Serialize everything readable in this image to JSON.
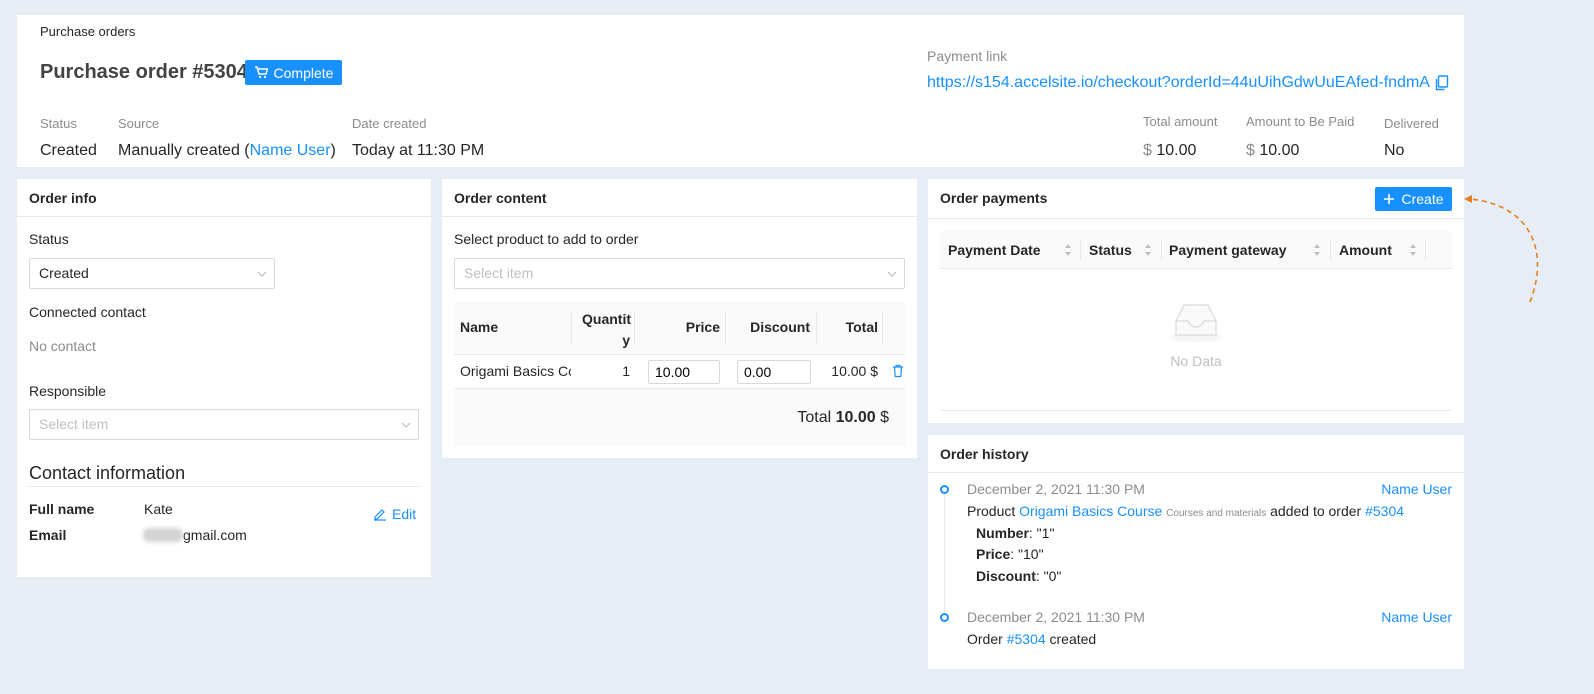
{
  "header": {
    "breadcrumb": "Purchase orders",
    "title": "Purchase order #5304",
    "complete_label": "Complete",
    "status_label": "Status",
    "status_value": "Created",
    "source_label": "Source",
    "source_prefix": "Manually created (",
    "source_user": "Name User",
    "source_suffix": ")",
    "date_label": "Date created",
    "date_value": "Today at 11:30 PM",
    "payment_link_label": "Payment link",
    "payment_link": "https://s154.accelsite.io/checkout?orderId=44uUihGdwUuEAfed-fndmA",
    "total_label": "Total amount",
    "total_currency": "$",
    "total_value": "10.00",
    "to_pay_label": "Amount to Be Paid",
    "to_pay_currency": "$",
    "to_pay_value": "10.00",
    "delivered_label": "Delivered",
    "delivered_value": "No"
  },
  "order_info": {
    "title": "Order info",
    "status_label": "Status",
    "status_value": "Created",
    "contact_label": "Connected contact",
    "contact_value": "No contact",
    "responsible_label": "Responsible",
    "responsible_placeholder": "Select item",
    "contact_info_title": "Contact information",
    "full_name_label": "Full name",
    "full_name_value": "Kate",
    "edit_label": "Edit",
    "email_label": "Email",
    "email_value": "gmail.com"
  },
  "order_content": {
    "title": "Order content",
    "select_label": "Select product to add to order",
    "select_placeholder": "Select item",
    "columns": {
      "name": "Name",
      "quantity_1": "Quantit",
      "quantity_2": "y",
      "price": "Price",
      "discount": "Discount",
      "total": "Total"
    },
    "row": {
      "name": "Origami Basics Cou",
      "quantity": "1",
      "price": "10.00",
      "discount": "0.00",
      "total": "10.00 $"
    },
    "total_label": "Total",
    "total_value": "10.00",
    "total_currency": "$"
  },
  "order_payments": {
    "title": "Order payments",
    "create_label": "Create",
    "columns": [
      "Payment Date",
      "Status",
      "Payment gateway",
      "Amount"
    ],
    "empty_text": "No Data"
  },
  "order_history": {
    "title": "Order history",
    "entries": [
      {
        "date": "December 2, 2021 11:30 PM",
        "user": "Name User",
        "prefix": "Product ",
        "product": "Origami Basics Course",
        "category": "Courses and materials",
        "middle": " added to order ",
        "order_ref": "#5304",
        "details": [
          {
            "key": "Number",
            "value": ": \"1\""
          },
          {
            "key": "Price",
            "value": ": \"10\""
          },
          {
            "key": "Discount",
            "value": ": \"0\""
          }
        ]
      },
      {
        "date": "December 2, 2021 11:30 PM",
        "user": "Name User",
        "prefix": "Order ",
        "order_ref": "#5304",
        "suffix": " created"
      }
    ]
  },
  "colors": {
    "accent": "#1890ff",
    "background": "#e7edf5",
    "annotation_arrow": "#e67e22"
  }
}
